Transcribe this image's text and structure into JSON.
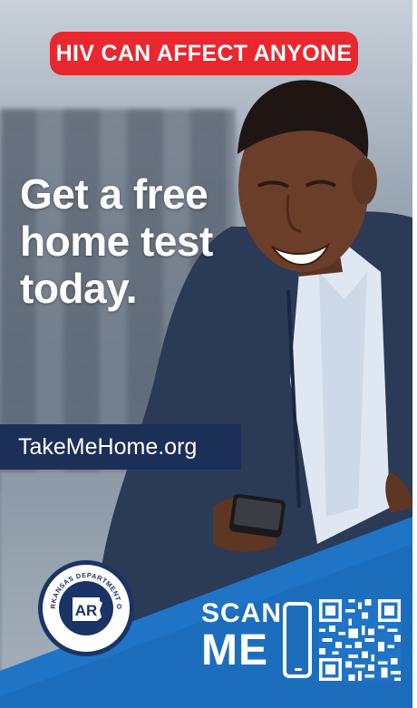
{
  "banner": {
    "text": "HIV CAN AFFECT ANYONE"
  },
  "headline": {
    "lines": [
      "Get a free",
      "home test",
      "today."
    ]
  },
  "url": {
    "text": "TakeMeHome.org"
  },
  "seal": {
    "org_text": "ARKANSAS DEPARTMENT OF HEALTH",
    "monogram": "AR"
  },
  "scan": {
    "line1": "SCAN",
    "line2": "ME"
  },
  "colors": {
    "red": "#e8272f",
    "navy": "#1c2f57",
    "blue": "#1f74c6",
    "light_blue": "#3d8ad6"
  }
}
